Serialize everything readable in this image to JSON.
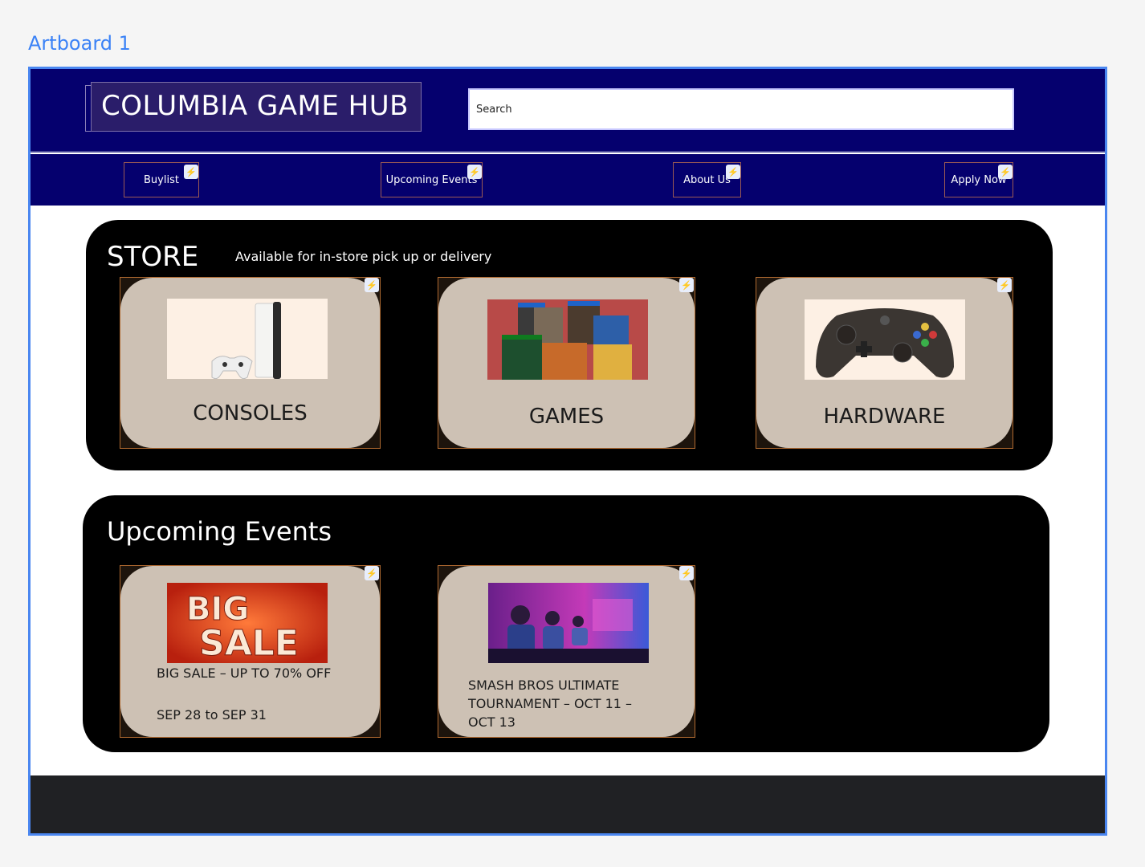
{
  "artboard": {
    "label": "Artboard 1"
  },
  "header": {
    "brand": "COLUMBIA GAME HUB",
    "search_value": "Search"
  },
  "nav": {
    "items": [
      {
        "label": "Buylist"
      },
      {
        "label": "Upcoming Events"
      },
      {
        "label": "About Us"
      },
      {
        "label": "Apply Now"
      }
    ]
  },
  "store": {
    "title": "STORE",
    "subtitle": "Available for in-store pick up or delivery",
    "cards": [
      {
        "label": "CONSOLES"
      },
      {
        "label": "GAMES"
      },
      {
        "label": "HARDWARE"
      }
    ]
  },
  "events": {
    "title": "Upcoming Events",
    "cards": [
      {
        "banner": "BIG SALE",
        "title": "BIG  SALE – UP TO 70% OFF",
        "dates": "SEP 28 to SEP 31"
      },
      {
        "title": "SMASH BROS ULTIMATE TOURNAMENT – OCT 11 – OCT 13"
      }
    ]
  },
  "colors": {
    "accent": "#4a86f0",
    "header_bg": "#05006e",
    "card_bg": "#cdc1b4",
    "footer_bg": "#202124"
  },
  "icons": [
    "bolt-icon",
    "playstation-console-image",
    "games-collage-image",
    "xbox-controller-image",
    "big-sale-banner-image",
    "tournament-photo-image"
  ]
}
